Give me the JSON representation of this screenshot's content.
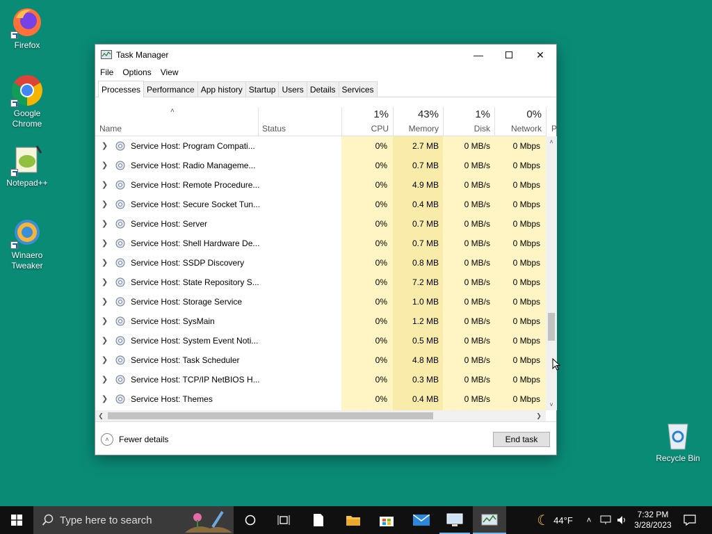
{
  "desktop": {
    "icons": [
      {
        "label": "Firefox"
      },
      {
        "label": "Google Chrome"
      },
      {
        "label": "Notepad++"
      },
      {
        "label": "Winaero Tweaker"
      },
      {
        "label": "Recycle Bin"
      }
    ]
  },
  "window": {
    "title": "Task Manager",
    "menu": [
      "File",
      "Options",
      "View"
    ],
    "tabs": [
      "Processes",
      "Performance",
      "App history",
      "Startup",
      "Users",
      "Details",
      "Services"
    ],
    "active_tab": "Processes",
    "columns": {
      "name": "Name",
      "status": "Status",
      "cpu": {
        "pct": "1%",
        "label": "CPU"
      },
      "memory": {
        "pct": "43%",
        "label": "Memory"
      },
      "disk": {
        "pct": "1%",
        "label": "Disk"
      },
      "network": {
        "pct": "0%",
        "label": "Network"
      },
      "power": "P"
    },
    "rows": [
      {
        "name": "Service Host: Program Compati...",
        "cpu": "0%",
        "memory": "2.7 MB",
        "disk": "0 MB/s",
        "network": "0 Mbps"
      },
      {
        "name": "Service Host: Radio Manageme...",
        "cpu": "0%",
        "memory": "0.7 MB",
        "disk": "0 MB/s",
        "network": "0 Mbps"
      },
      {
        "name": "Service Host: Remote Procedure...",
        "cpu": "0%",
        "memory": "4.9 MB",
        "disk": "0 MB/s",
        "network": "0 Mbps"
      },
      {
        "name": "Service Host: Secure Socket Tun...",
        "cpu": "0%",
        "memory": "0.4 MB",
        "disk": "0 MB/s",
        "network": "0 Mbps"
      },
      {
        "name": "Service Host: Server",
        "cpu": "0%",
        "memory": "0.7 MB",
        "disk": "0 MB/s",
        "network": "0 Mbps"
      },
      {
        "name": "Service Host: Shell Hardware De...",
        "cpu": "0%",
        "memory": "0.7 MB",
        "disk": "0 MB/s",
        "network": "0 Mbps"
      },
      {
        "name": "Service Host: SSDP Discovery",
        "cpu": "0%",
        "memory": "0.8 MB",
        "disk": "0 MB/s",
        "network": "0 Mbps"
      },
      {
        "name": "Service Host: State Repository S...",
        "cpu": "0%",
        "memory": "7.2 MB",
        "disk": "0 MB/s",
        "network": "0 Mbps"
      },
      {
        "name": "Service Host: Storage Service",
        "cpu": "0%",
        "memory": "1.0 MB",
        "disk": "0 MB/s",
        "network": "0 Mbps"
      },
      {
        "name": "Service Host: SysMain",
        "cpu": "0%",
        "memory": "1.2 MB",
        "disk": "0 MB/s",
        "network": "0 Mbps"
      },
      {
        "name": "Service Host: System Event Noti...",
        "cpu": "0%",
        "memory": "0.5 MB",
        "disk": "0 MB/s",
        "network": "0 Mbps"
      },
      {
        "name": "Service Host: Task Scheduler",
        "cpu": "0%",
        "memory": "4.8 MB",
        "disk": "0 MB/s",
        "network": "0 Mbps"
      },
      {
        "name": "Service Host: TCP/IP NetBIOS H...",
        "cpu": "0%",
        "memory": "0.3 MB",
        "disk": "0 MB/s",
        "network": "0 Mbps"
      },
      {
        "name": "Service Host: Themes",
        "cpu": "0%",
        "memory": "0.4 MB",
        "disk": "0 MB/s",
        "network": "0 Mbps"
      }
    ],
    "fewer_details": "Fewer details",
    "end_task": "End task"
  },
  "taskbar": {
    "search_placeholder": "Type here to search",
    "weather": "44°F",
    "time": "7:32 PM",
    "date": "3/28/2023"
  }
}
